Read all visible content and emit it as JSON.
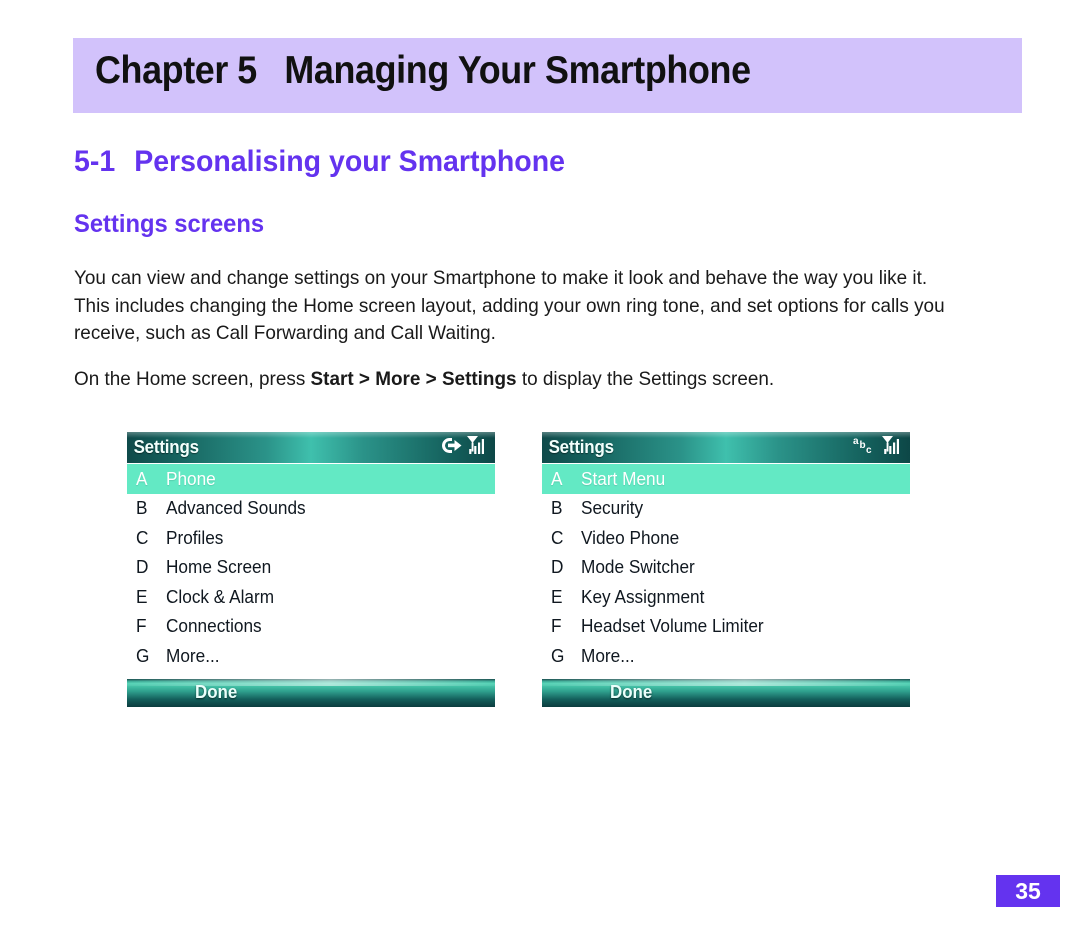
{
  "chapter": {
    "prefix": "Chapter",
    "number": "5",
    "title": "Managing Your Smartphone",
    "band_color": "#d2c2fb"
  },
  "section": {
    "number": "5-1",
    "title": "Personalising your Smartphone",
    "subtitle": "Settings screens",
    "heading_color": "#6433ef"
  },
  "body": {
    "paragraph1": "You can view and change settings on your Smartphone to make it look and behave the way you like it. This includes changing the Home screen layout, adding your own ring tone, and set options for calls you receive, such as Call Forwarding and Call Waiting.",
    "paragraph2_before": "On the Home screen, press ",
    "paragraph2_path": "Start > More > Settings",
    "paragraph2_after": " to display the Settings screen."
  },
  "screens": [
    {
      "id": "settings-screen-1",
      "title": "Settings",
      "status_icons": [
        "call-connection-icon",
        "signal-strength-icon"
      ],
      "softkey": "Done",
      "selected_index": 0,
      "items": [
        {
          "letter": "A",
          "label": "Phone"
        },
        {
          "letter": "B",
          "label": "Advanced Sounds"
        },
        {
          "letter": "C",
          "label": "Profiles"
        },
        {
          "letter": "D",
          "label": "Home Screen"
        },
        {
          "letter": "E",
          "label": "Clock & Alarm"
        },
        {
          "letter": "F",
          "label": "Connections"
        },
        {
          "letter": "G",
          "label": "More..."
        }
      ]
    },
    {
      "id": "settings-screen-2",
      "title": "Settings",
      "status_icons": [
        "abc-input-mode-icon",
        "signal-strength-icon"
      ],
      "softkey": "Done",
      "selected_index": 0,
      "items": [
        {
          "letter": "A",
          "label": "Start Menu"
        },
        {
          "letter": "B",
          "label": "Security"
        },
        {
          "letter": "C",
          "label": "Video Phone"
        },
        {
          "letter": "D",
          "label": "Mode Switcher"
        },
        {
          "letter": "E",
          "label": "Key Assignment"
        },
        {
          "letter": "F",
          "label": "Headset Volume Limiter"
        },
        {
          "letter": "G",
          "label": "More..."
        }
      ]
    }
  ],
  "footer": {
    "page_number": "35",
    "badge_color": "#6433ef"
  }
}
